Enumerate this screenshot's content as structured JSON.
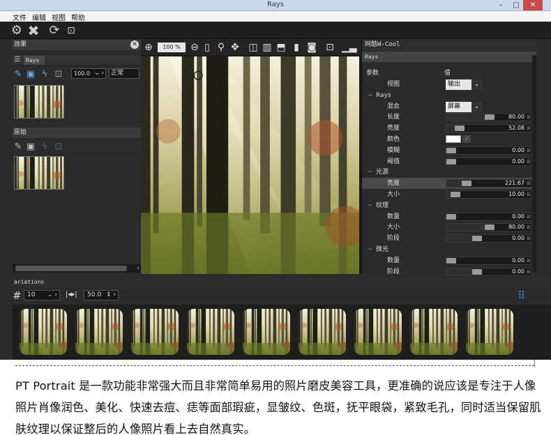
{
  "window": {
    "title": "Rays"
  },
  "menu": [
    "文件",
    "编辑",
    "视图",
    "帮助"
  ],
  "left_panel": {
    "title": "效果",
    "layers": [
      {
        "tab": "Rays",
        "opacity": "100.0",
        "blend": "正常"
      },
      {
        "tab": "原始"
      }
    ]
  },
  "viewer": {
    "zoom": "100 %"
  },
  "right_panel": {
    "title": "网酷W-Cool",
    "subtitle": "Rays",
    "col_param": "参数",
    "col_value": "值",
    "rows": [
      {
        "label": "视图",
        "indent": 2,
        "type": "dropdown",
        "value": "输出"
      },
      {
        "label": "Rays",
        "indent": 1,
        "type": "group",
        "tree": "−"
      },
      {
        "label": "混合",
        "indent": 2,
        "type": "dropdown",
        "value": "屏幕"
      },
      {
        "label": "长度",
        "indent": 2,
        "type": "slider",
        "value": "80.00",
        "level": 0.45
      },
      {
        "label": "亮度",
        "indent": 2,
        "type": "slider",
        "value": "52.08",
        "level": 0.1
      },
      {
        "label": "颜色",
        "indent": 2,
        "type": "color",
        "value": "#ffffff"
      },
      {
        "label": "模糊",
        "indent": 2,
        "type": "slider",
        "value": "0.00",
        "level": 0
      },
      {
        "label": "阈值",
        "indent": 2,
        "type": "slider",
        "value": "0.00",
        "level": 0
      },
      {
        "label": "光源",
        "indent": 1,
        "type": "group",
        "tree": "−"
      },
      {
        "label": "亮度",
        "indent": 2,
        "type": "slider",
        "value": "221.67",
        "level": 0.18,
        "selected": true
      },
      {
        "label": "大小",
        "indent": 2,
        "type": "slider",
        "value": "10.00",
        "level": 0.05
      },
      {
        "label": "纹理",
        "indent": 1,
        "type": "group",
        "tree": "−"
      },
      {
        "label": "数量",
        "indent": 2,
        "type": "slider",
        "value": "0.00",
        "level": 0
      },
      {
        "label": "大小",
        "indent": 2,
        "type": "slider",
        "value": "80.00",
        "level": 0.45
      },
      {
        "label": "阶段",
        "indent": 2,
        "type": "slider",
        "value": "0.00",
        "level": 0.3
      },
      {
        "label": "微光",
        "indent": 1,
        "type": "group",
        "tree": "−"
      },
      {
        "label": "数量",
        "indent": 2,
        "type": "slider",
        "value": "0.00",
        "level": 0
      },
      {
        "label": "阶段",
        "indent": 2,
        "type": "slider",
        "value": "0.00",
        "level": 0.3
      }
    ]
  },
  "variations": {
    "title": "ariations",
    "count": "10",
    "spread": "50.0",
    "thumb_count": 9
  },
  "caption": {
    "text": "PT Portrait 是一款功能非常强大而且非常简单易用的照片磨皮美容工具，更准确的说应该是专注于人像照片肖像润色、美化、快速去痘、痣等面部瑕疵，显皱纹、色斑，抚平眼袋，紧致毛孔，同时适当保留肌肤纹理以保证整后的人像照片看上去自然真实。"
  },
  "colors": {
    "accent": "#4a90d9",
    "panel": "#2a2a2a",
    "titlebar": "#c9d9ea"
  }
}
